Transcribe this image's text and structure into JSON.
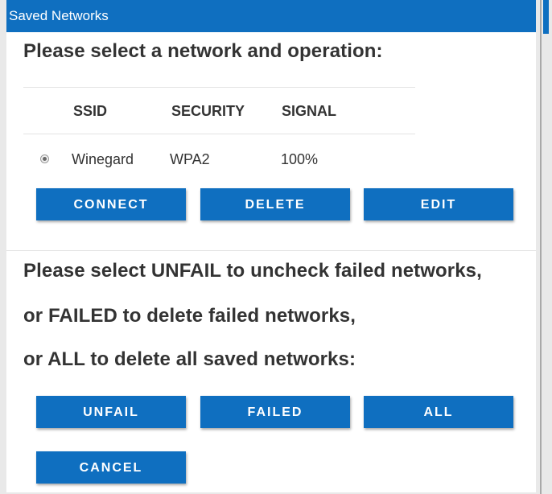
{
  "window": {
    "title": "Saved Networks"
  },
  "section1": {
    "heading": "Please select a network and operation:"
  },
  "table": {
    "headers": [
      "SSID",
      "SECURITY",
      "SIGNAL"
    ],
    "rows": [
      {
        "selected": true,
        "ssid": "Winegard",
        "security": "WPA2",
        "signal": "100%"
      }
    ]
  },
  "actions": {
    "connect": "CONNECT",
    "delete": "DELETE",
    "edit": "EDIT"
  },
  "section2": {
    "line1": "Please select UNFAIL to uncheck failed networks,",
    "line2": "or FAILED to delete failed networks,",
    "line3": "or ALL to delete all saved networks:"
  },
  "actions2": {
    "unfail": "UNFAIL",
    "failed": "FAILED",
    "all": "ALL",
    "cancel": "CANCEL"
  },
  "colors": {
    "accent": "#0f6fc0",
    "text": "#333333",
    "background": "#ffffff"
  }
}
